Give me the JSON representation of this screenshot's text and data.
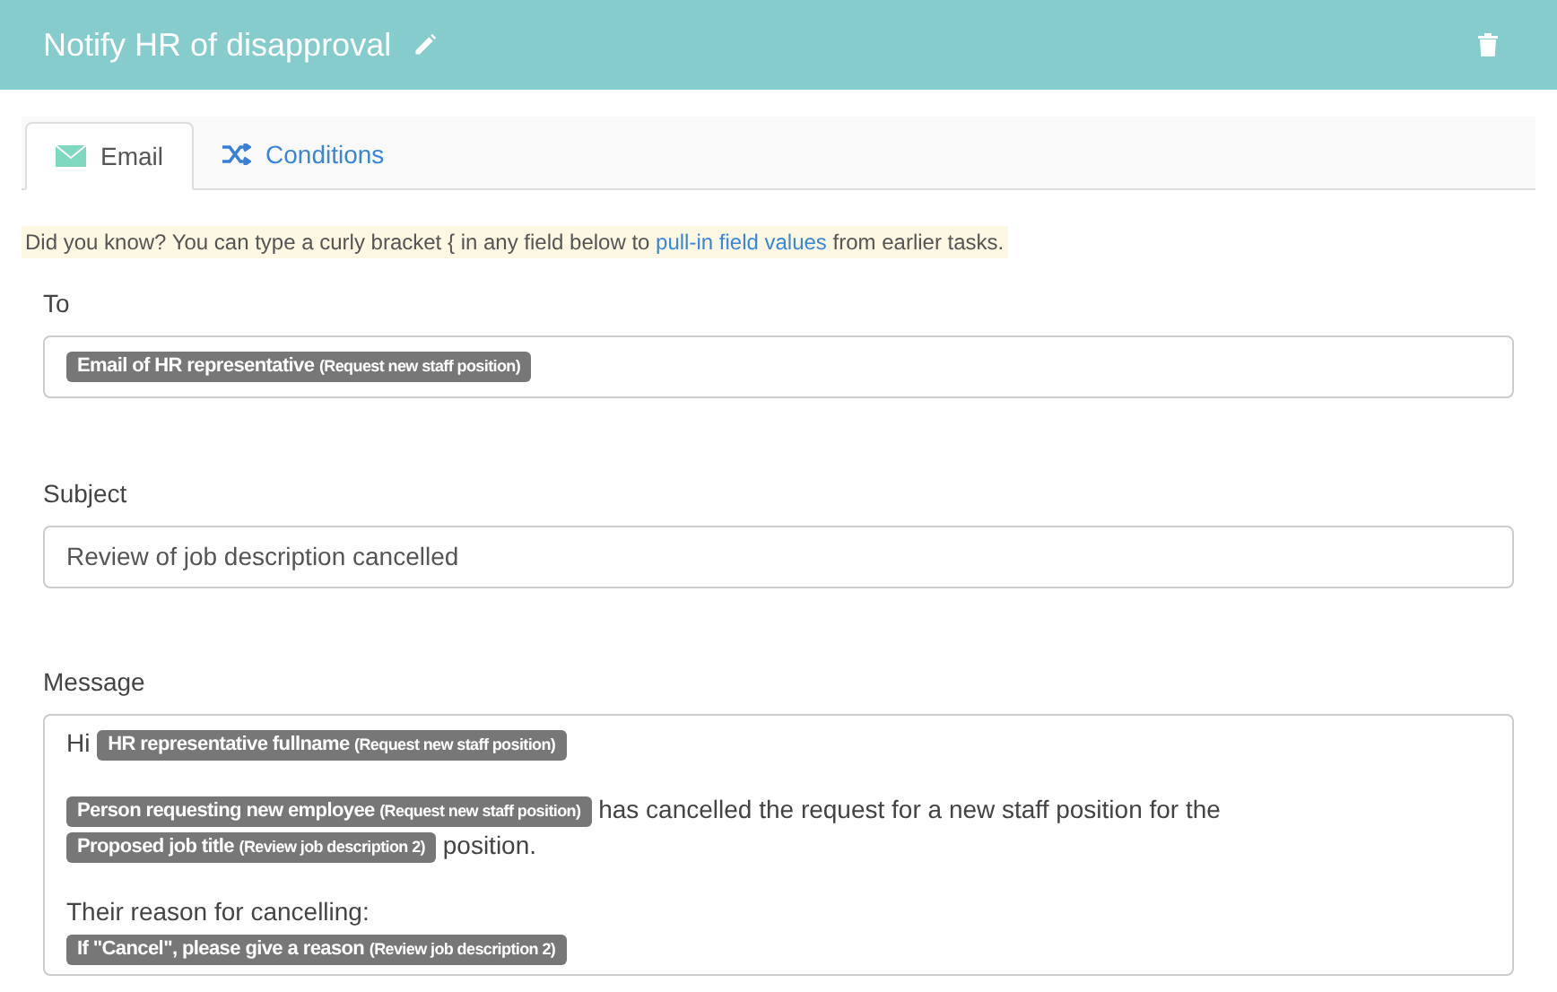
{
  "header": {
    "title": "Notify HR of disapproval"
  },
  "tabs": [
    {
      "label": "Email",
      "kind": "email",
      "selected": true
    },
    {
      "label": "Conditions",
      "kind": "conditions",
      "selected": false
    }
  ],
  "tip": {
    "before": "Did you know? You can type a curly bracket { in any field below to",
    "link": "pull-in field values",
    "after": "from earlier tasks."
  },
  "to": {
    "label": "To",
    "tokens": [
      {
        "field": "Email of HR representative",
        "source": "(Request new staff position)"
      }
    ]
  },
  "subject": {
    "label": "Subject",
    "value": "Review of job description cancelled"
  },
  "message": {
    "label": "Message",
    "paragraphs": [
      [
        [
          {
            "kind": "text",
            "text": "Hi"
          },
          {
            "kind": "token",
            "field": "HR representative fullname",
            "source": "(Request new staff position)"
          }
        ]
      ],
      [
        [
          {
            "kind": "token",
            "field": "Person requesting new employee",
            "source": "(Request new staff position)"
          },
          {
            "kind": "text",
            "text": "has cancelled the request for a new staff position for the"
          },
          {
            "kind": "token",
            "field": "Proposed job title",
            "source": "(Review job description 2)"
          },
          {
            "kind": "text",
            "text": "position."
          }
        ]
      ],
      [
        [
          {
            "kind": "text",
            "text": "Their reason for cancelling:"
          }
        ],
        [
          {
            "kind": "token",
            "field": "If \"Cancel\", please give a reason",
            "source": "(Review job description 2)"
          }
        ]
      ]
    ]
  }
}
